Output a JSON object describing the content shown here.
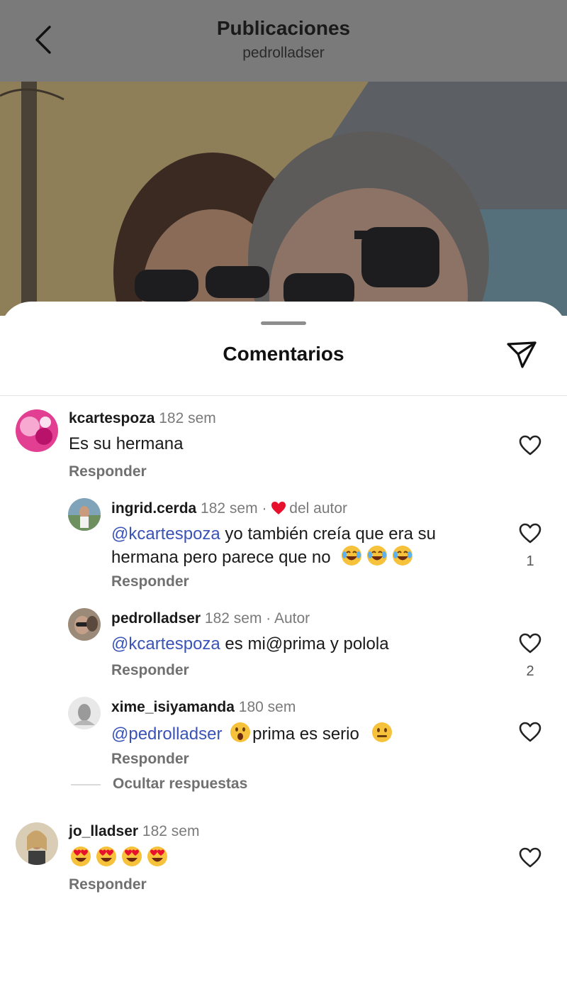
{
  "header": {
    "title": "Publicaciones",
    "subtitle": "pedrolladser"
  },
  "sheet": {
    "title": "Comentarios"
  },
  "comments": [
    {
      "username": "kcartespoza",
      "time": "182 sem",
      "text": "Es su hermana",
      "reply_label": "Responder"
    },
    {
      "username": "ingrid.cerda",
      "time": "182 sem",
      "separator": "·",
      "author_like_label": "del autor",
      "mention": "@kcartespoza",
      "text_line1": " yo también creía que era su",
      "text_line2": "hermana pero parece que no",
      "likes": "1",
      "reply_label": "Responder"
    },
    {
      "username": "pedrolladser",
      "time": "182 sem",
      "separator": "·",
      "badge": "Autor",
      "mention": "@kcartespoza",
      "text": " es mi@prima y pololа",
      "likes": "2",
      "reply_label": "Responder"
    },
    {
      "username": "xime_isiyamanda",
      "time": "180 sem",
      "mention": "@pedrolladser",
      "text": "prima es serio",
      "reply_label": "Responder"
    },
    {
      "username": "jo_lladser",
      "time": "182 sem",
      "reply_label": "Responder"
    }
  ],
  "hide_replies_label": "Ocultar respuestas",
  "icons": {
    "back": "chevron-left-icon",
    "filter": "filter-icon",
    "like": "heart-outline-icon",
    "author_like": "heart-filled-icon",
    "emoji_laugh": "face-with-tears-of-joy-icon",
    "emoji_surprised": "hushed-face-icon",
    "emoji_neutral": "neutral-face-icon",
    "emoji_love": "heart-eyes-face-icon"
  },
  "colors": {
    "mention": "#3a53b8",
    "author_heart": "#e8112d",
    "secondary_text": "#7a7a7a"
  }
}
